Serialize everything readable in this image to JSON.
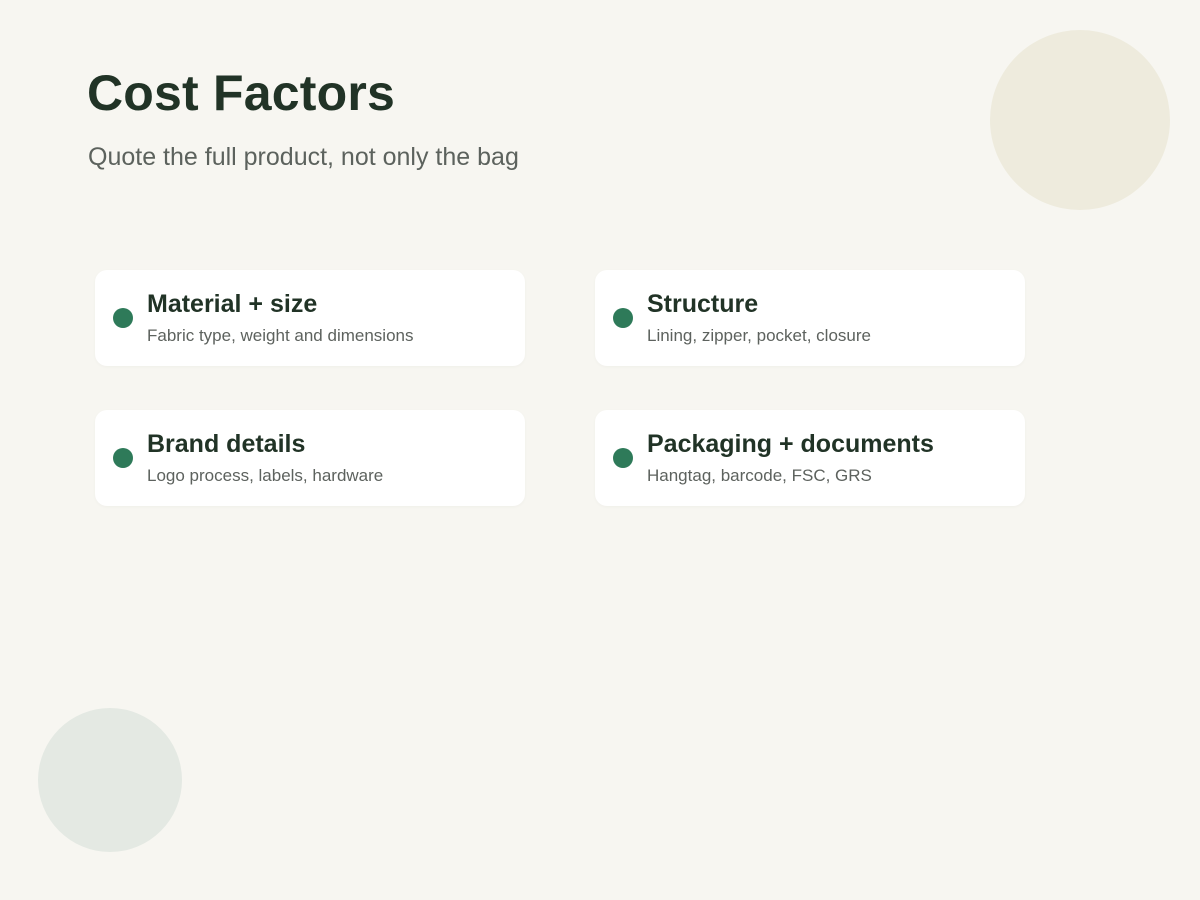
{
  "slide": {
    "title": "Cost Factors",
    "subtitle": "Quote the full product, not only the bag"
  },
  "colors": {
    "background": "#f7f6f1",
    "title": "#213326",
    "accent": "#2e7a59",
    "deco_top": "#eeebdd",
    "deco_bottom": "#e4e9e3"
  },
  "factors": [
    {
      "title": "Material + size",
      "description": "Fabric type, weight and dimensions",
      "icon": "bullet-dot-icon"
    },
    {
      "title": "Structure",
      "description": "Lining, zipper, pocket, closure",
      "icon": "bullet-dot-icon"
    },
    {
      "title": "Brand details",
      "description": "Logo process, labels, hardware",
      "icon": "bullet-dot-icon"
    },
    {
      "title": "Packaging + documents",
      "description": "Hangtag, barcode, FSC, GRS",
      "icon": "bullet-dot-icon"
    }
  ]
}
